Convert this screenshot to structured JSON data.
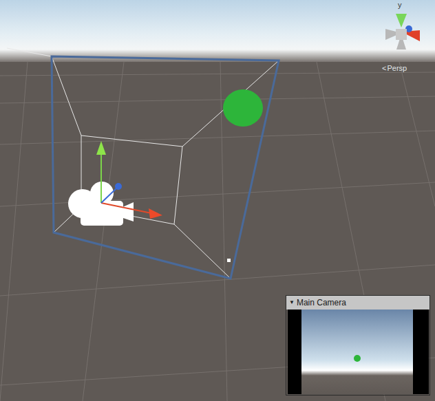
{
  "scene": {
    "view_mode": {
      "icon": "<",
      "label": "Persp"
    },
    "gizmo": {
      "axis_label": "y"
    }
  },
  "camera_preview": {
    "toggle": "▼",
    "title": "Main Camera",
    "expanded": true
  }
}
